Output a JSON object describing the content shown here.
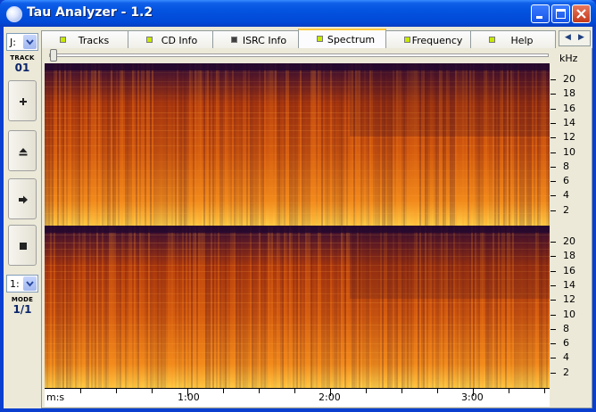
{
  "window": {
    "title": "Tau Analyzer - 1.2"
  },
  "left_panel": {
    "drive_select": "J:",
    "track_label": "TRACK",
    "track_number": "01",
    "mode_select": "1:",
    "mode_label": "MODE",
    "mode_value": "1/1"
  },
  "tabs": [
    {
      "label": "Tracks",
      "led": "on"
    },
    {
      "label": "CD Info",
      "led": "on"
    },
    {
      "label": "ISRC Info",
      "led": "off"
    },
    {
      "label": "Spectrum",
      "led": "on",
      "active": true
    },
    {
      "label": "Frequency",
      "led": "on"
    },
    {
      "label": "Help",
      "led": "on"
    }
  ],
  "spectrum": {
    "unit_label": "kHz",
    "freq_ticks": [
      "20",
      "18",
      "16",
      "14",
      "12",
      "10",
      "8",
      "6",
      "4",
      "2"
    ],
    "time_axis": {
      "unit_label": "m:s",
      "ticks": [
        "1:00",
        "2:00",
        "3:00"
      ]
    },
    "colors": {
      "low": "#ffd24a",
      "mid": "#d4520a",
      "high": "#2a0d3a"
    }
  }
}
